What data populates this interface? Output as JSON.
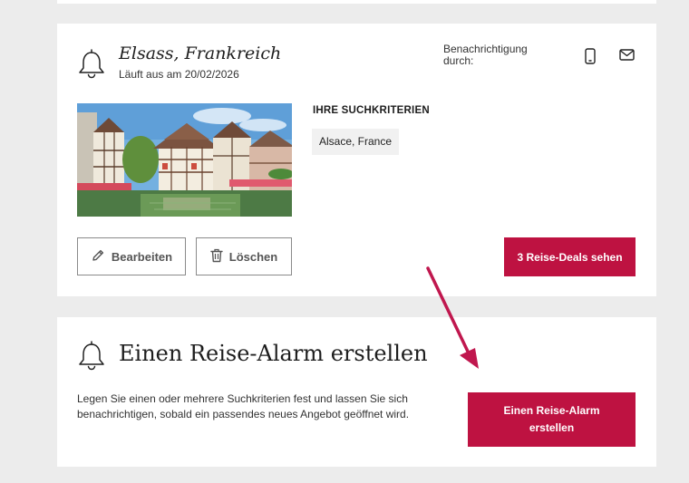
{
  "alert": {
    "title": "Elsass, Frankreich",
    "expiry": "Läuft aus am 20/02/2026",
    "notification_label": "Benachrichtigung durch:",
    "criteria_heading": "IHRE SUCHKRITERIEN",
    "criteria_tag": "Alsace, France",
    "edit_label": "Bearbeiten",
    "delete_label": "Löschen",
    "deals_label": "3 Reise-Deals sehen"
  },
  "create": {
    "title": "Einen Reise-Alarm erstellen",
    "description": "Legen Sie einen oder mehrere Suchkriterien fest und lassen Sie sich benachrichtigen, sobald ein passendes neues Angebot geöffnet wird.",
    "button_label": "Einen Reise-Alarm erstellen"
  },
  "colors": {
    "accent": "#be1241",
    "annotation_arrow": "#c0174e",
    "page_background": "#ececec"
  },
  "icons": {
    "alert_bell": "bell-icon",
    "create_bell": "bell-icon",
    "sms": "phone-icon",
    "email": "mail-icon",
    "edit": "pencil-icon",
    "delete": "trash-icon"
  }
}
